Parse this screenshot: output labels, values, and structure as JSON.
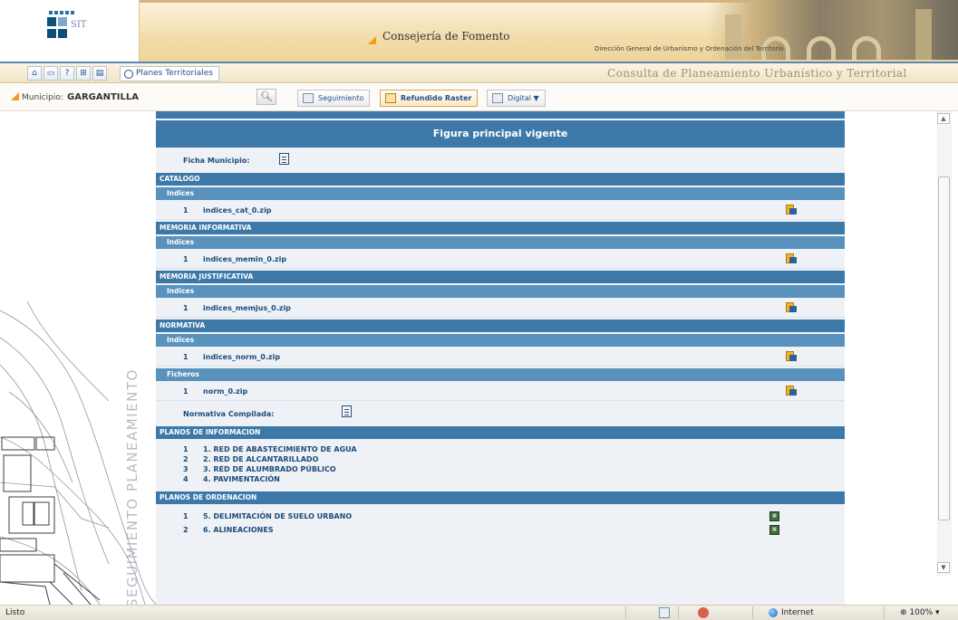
{
  "header": {
    "logo_text": "SIT",
    "consejeria": "Consejería de Fomento",
    "direccion": "Dirección General de Urbanismo y Ordenación del Territorio"
  },
  "toolbar": {
    "planes_label": "Planes Territoriales",
    "consulta_title": "Consulta de Planeamiento Urbanístico y Territorial"
  },
  "municipio": {
    "label": "Municipio:",
    "value": "GARGANTILLA"
  },
  "tabs": {
    "seguimiento": "Seguimiento",
    "refundido": "Refundido Raster",
    "digital": "Digital ▼"
  },
  "left_panel": {
    "vertical_text": "SEGUIMIENTO PLANEAMIENTO"
  },
  "content": {
    "title": "Figura principal vigente",
    "ficha_label": "Ficha Municipio:",
    "sections": {
      "catalogo": "CATALOGO",
      "memoria_informativa": "MEMORIA INFORMATIVA",
      "memoria_justificativa": "MEMORIA JUSTIFICATIVA",
      "normativa": "NORMATIVA",
      "planos_informacion": "PLANOS DE INFORMACION",
      "planos_ordenacion": "PLANOS DE ORDENACION"
    },
    "sub_indices": "Indices",
    "sub_ficheros": "Ficheros",
    "files": {
      "cat": {
        "num": "1",
        "name": "indices_cat_0.zip"
      },
      "memin": {
        "num": "1",
        "name": "indices_memin_0.zip"
      },
      "memjus": {
        "num": "1",
        "name": "indices_memjus_0.zip"
      },
      "norm": {
        "num": "1",
        "name": "indices_norm_0.zip"
      },
      "normzip": {
        "num": "1",
        "name": "norm_0.zip"
      }
    },
    "normativa_compilada": "Normativa Compilada:",
    "planos_informacion_items": [
      {
        "num": "1",
        "name": "1. RED DE ABASTECIMIENTO DE AGUA"
      },
      {
        "num": "2",
        "name": "2. RED DE ALCANTARILLADO"
      },
      {
        "num": "3",
        "name": "3. RED DE ALUMBRADO PÚBLICO"
      },
      {
        "num": "4",
        "name": "4. PAVIMENTACIÓN"
      }
    ],
    "planos_ordenacion_items": [
      {
        "num": "1",
        "name": "5. DELIMITACIÓN DE SUELO URBANO"
      },
      {
        "num": "2",
        "name": "6. ALINEACIONES"
      }
    ]
  },
  "statusbar": {
    "status": "Listo",
    "zone": "Internet",
    "zoom": "100%"
  },
  "colors": {
    "section_blue": "#3d79a8",
    "sub_blue": "#5a92be",
    "accent_orange": "#f39c1e"
  }
}
